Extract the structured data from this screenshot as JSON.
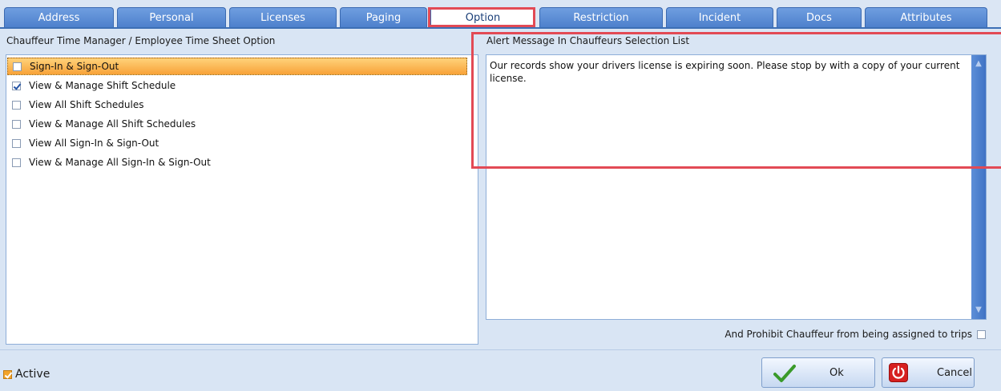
{
  "tabs": [
    {
      "label": "Address"
    },
    {
      "label": "Personal"
    },
    {
      "label": "Licenses"
    },
    {
      "label": "Paging"
    },
    {
      "label": "Option",
      "active": true
    },
    {
      "label": "Restriction"
    },
    {
      "label": "Incident"
    },
    {
      "label": "Docs"
    },
    {
      "label": "Attributes"
    }
  ],
  "left_panel": {
    "title": "Chauffeur Time Manager / Employee Time Sheet Option",
    "items": [
      {
        "label": "Sign-In & Sign-Out",
        "checked": false,
        "selected": true
      },
      {
        "label": "View & Manage Shift Schedule",
        "checked": true
      },
      {
        "label": "View All Shift Schedules",
        "checked": false
      },
      {
        "label": "View & Manage All Shift Schedules",
        "checked": false
      },
      {
        "label": "View All Sign-In & Sign-Out",
        "checked": false
      },
      {
        "label": "View & Manage All Sign-In & Sign-Out",
        "checked": false
      }
    ]
  },
  "right_panel": {
    "title": "Alert Message In Chauffeurs Selection List",
    "alert_text": "Our records show your drivers license is expiring soon.  Please stop by with a copy of your current license.",
    "prohibit_label": "And Prohibit Chauffeur from being assigned to trips",
    "prohibit_checked": false
  },
  "footer": {
    "active_label": "Active",
    "active_checked": true,
    "ok_label": "Ok",
    "cancel_label": "Cancel"
  },
  "colors": {
    "tab_blue": "#4c7fcb",
    "selection_orange": "#f8a238",
    "highlight_red": "#e24a55",
    "scrollbar_blue": "#3f72c4"
  },
  "icons": {
    "ok": "check-icon",
    "cancel": "power-icon"
  }
}
